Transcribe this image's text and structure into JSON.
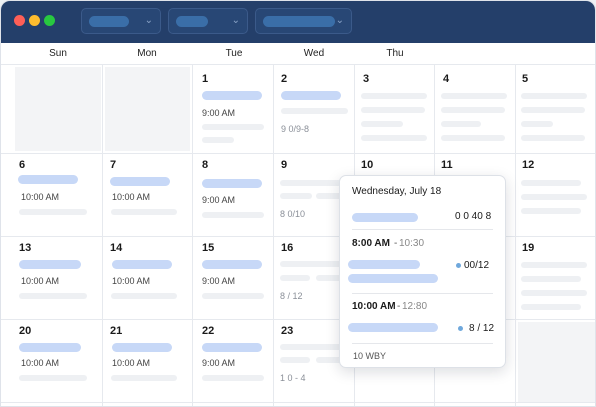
{
  "weekdays": [
    "Sun",
    "Mon",
    "Tue",
    "Wed",
    "Thu"
  ],
  "days": {
    "d1": "1",
    "d2": "2",
    "d3": "3",
    "d4": "4",
    "d5": "5",
    "d6": "6",
    "d7": "7",
    "d8": "8",
    "d9": "9",
    "d10": "10",
    "d11": "11",
    "d12": "12",
    "d13": "13",
    "d14": "14",
    "d15": "15",
    "d16": "16",
    "d19": "19",
    "d20": "20",
    "d21": "21",
    "d22": "22",
    "d23": "23"
  },
  "cells": {
    "c1_time": "9:00 AM",
    "c2_text": "9 0/9-8",
    "c6_time": "10:00 AM",
    "c7_time": "10:00 AM",
    "c8_time": "9:00 AM",
    "c9_text": "8 0/10",
    "c13_time": "10:00 AM",
    "c14_time": "10:00 AM",
    "c15_time": "9:00 AM",
    "c16_text": "8 / 12",
    "c20_time": "10:00 AM",
    "c21_time": "10:00 AM",
    "c22_time": "9:00 AM",
    "c23_text": "1 0 - 4"
  },
  "popup": {
    "title": "Wednesday, July 18",
    "row1_value": "0 0 40 8",
    "slot1_start": "8:00 AM",
    "slot1_dash": "-",
    "slot1_end": "10:30",
    "slot1_count": "00/12",
    "slot2_start": "10:00 AM",
    "slot2_dash": "-",
    "slot2_end": "12:80",
    "slot2_count": "8 / 12",
    "footer": "10 WBY"
  },
  "colors": {
    "titlebar": "#243f6a",
    "traffic": [
      "#ff5f57",
      "#febc2e",
      "#28c840"
    ],
    "event": "#c7d8f7",
    "placeholder": "#eef0f3",
    "dot": "#6fa8dc"
  }
}
